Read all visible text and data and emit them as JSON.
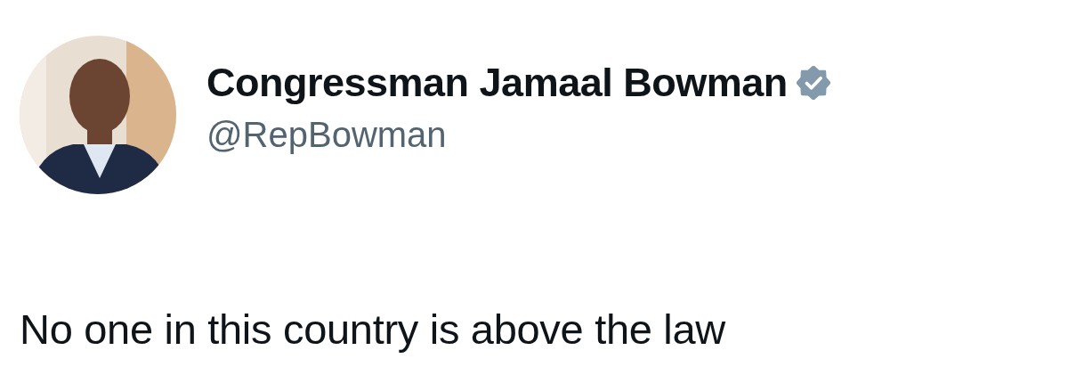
{
  "author": {
    "name": "Congressman Jamaal Bowman",
    "verified": true,
    "handle": "@RepBowman"
  },
  "tweet": {
    "text": "No one in this country is above the law"
  }
}
